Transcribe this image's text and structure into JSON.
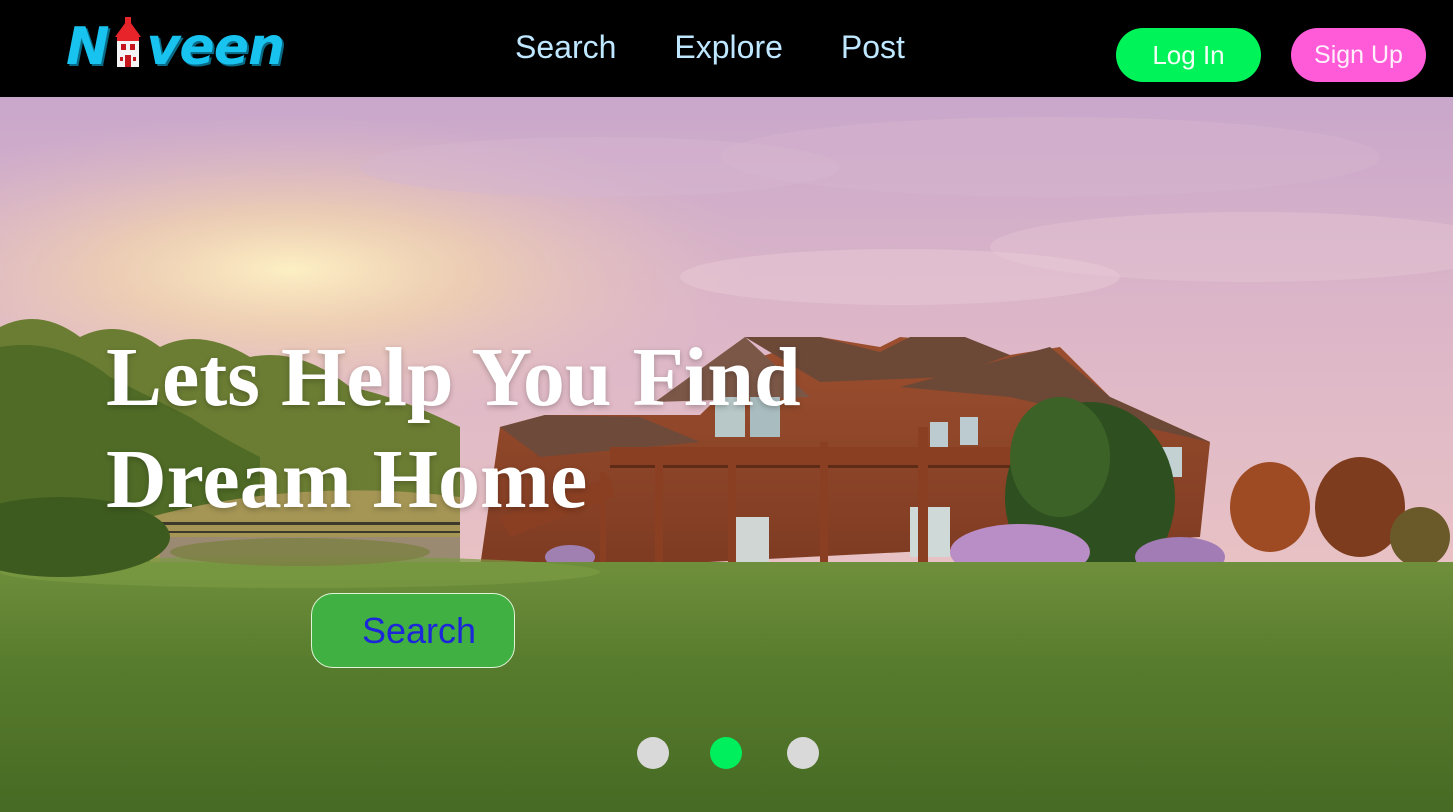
{
  "brand": {
    "logo_left": "N",
    "logo_right": "veen",
    "logo_color": "#19c3f0"
  },
  "nav": {
    "items": [
      {
        "label": "Search"
      },
      {
        "label": "Explore"
      },
      {
        "label": "Post"
      }
    ]
  },
  "auth": {
    "login_label": "Log In",
    "signup_label": "Sign Up",
    "login_color": "#00f45a",
    "signup_color": "#ff5ad8"
  },
  "hero": {
    "title_line1": "Lets Help You Find",
    "title_line2": "Dream Home",
    "search_label": "Search",
    "background_image": "wooden-house-sunset-icon"
  },
  "carousel": {
    "slide_count": 3,
    "active_index": 1,
    "active_color": "#00ef5c",
    "inactive_color": "#d9d9d9"
  }
}
